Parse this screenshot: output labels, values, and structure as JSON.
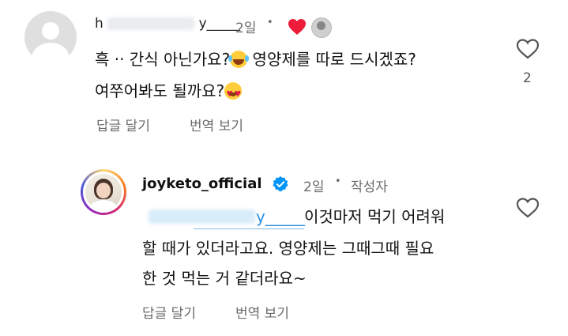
{
  "comment": {
    "username_visible_start": "h",
    "username_visible_end": "y_____",
    "time": "2일",
    "dot": "•",
    "text_line1_a": "흑 ·· 간식 아닌가요?",
    "text_line1_b": " 영양제를  따로 드시겠죠?",
    "text_line2_a": "여쭈어봐도 될까요?",
    "reply_action": "답글 달기",
    "translate_action": "번역 보기",
    "like_count": "2",
    "emoji_1": "face-with-tears-of-joy-emoji",
    "emoji_2": "heart-eyes-emoji"
  },
  "reply": {
    "username": "joyketo_official",
    "time": "2일",
    "dot": "•",
    "author_label": "작성자",
    "mention_visible_end": "y_____",
    "text_line1": " 이것마저 먹기 어려워",
    "text_line2": "할 때가 있더라고요. 영양제는 그때그때 필요",
    "text_line3": "한 것 먹는 거 같더라요~",
    "reply_action": "답글 달기",
    "translate_action": "번역 보기"
  },
  "colors": {
    "heart_red": "#ed1c3a",
    "verified_blue": "#0095f6",
    "meta_gray": "#6b6b6b",
    "mention_blue": "#0095f6"
  },
  "icons": [
    "heart-filled-icon",
    "heart-outline-icon",
    "verified-badge-icon"
  ]
}
